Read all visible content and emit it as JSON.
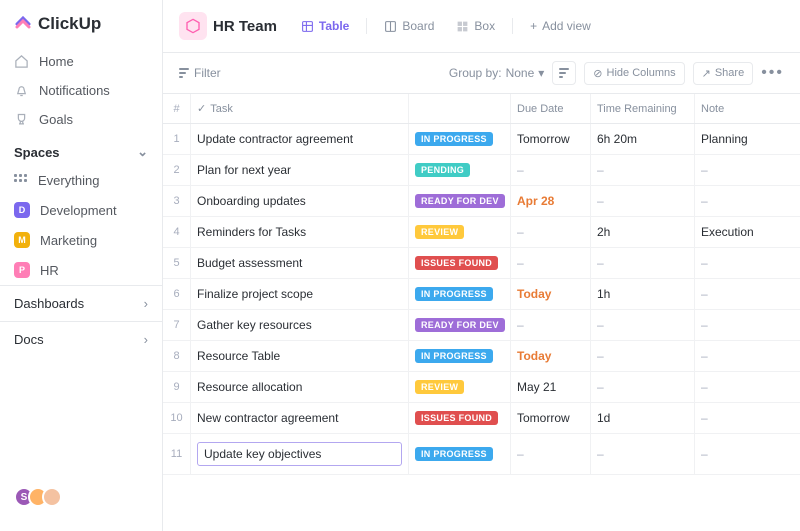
{
  "brand": "ClickUp",
  "nav": {
    "home": "Home",
    "notifications": "Notifications",
    "goals": "Goals"
  },
  "spaces_head": "Spaces",
  "everything": "Everything",
  "spaces": [
    {
      "letter": "D",
      "label": "Development",
      "color": "#7b68ee"
    },
    {
      "letter": "M",
      "label": "Marketing",
      "color": "#f2b10d"
    },
    {
      "letter": "P",
      "label": "HR",
      "color": "#ff7eb6"
    }
  ],
  "sections": {
    "dashboards": "Dashboards",
    "docs": "Docs"
  },
  "avatars": [
    "S",
    "",
    ""
  ],
  "header": {
    "title": "HR Team",
    "views": {
      "table": "Table",
      "board": "Board",
      "box": "Box",
      "add": "Add view"
    }
  },
  "toolbar": {
    "filter": "Filter",
    "group_by_label": "Group by:",
    "group_by_value": "None",
    "hide_cols": "Hide Columns",
    "share": "Share"
  },
  "columns": {
    "num": "#",
    "task": "Task",
    "status": "",
    "due": "Due Date",
    "time": "Time Remaining",
    "note": "Note"
  },
  "status_labels": {
    "inprogress": "IN PROGRESS",
    "pending": "PENDING",
    "readyfordev": "READY FOR DEV",
    "review": "REVIEW",
    "issuesfound": "ISSUES FOUND"
  },
  "rows": [
    {
      "n": "1",
      "task": "Update contractor agreement",
      "status": "inprogress",
      "due": "Tomorrow",
      "due_style": "",
      "time": "6h 20m",
      "note": "Planning"
    },
    {
      "n": "2",
      "task": "Plan for next year",
      "status": "pending",
      "due": "–",
      "due_style": "dash",
      "time": "–",
      "note": "–"
    },
    {
      "n": "3",
      "task": "Onboarding updates",
      "status": "readyfordev",
      "due": "Apr 28",
      "due_style": "orange",
      "time": "–",
      "note": "–"
    },
    {
      "n": "4",
      "task": "Reminders for Tasks",
      "status": "review",
      "due": "–",
      "due_style": "dash",
      "time": "2h",
      "note": "Execution"
    },
    {
      "n": "5",
      "task": "Budget assessment",
      "status": "issuesfound",
      "due": "–",
      "due_style": "dash",
      "time": "–",
      "note": "–"
    },
    {
      "n": "6",
      "task": "Finalize project scope",
      "status": "inprogress",
      "due": "Today",
      "due_style": "orange",
      "time": "1h",
      "note": "–"
    },
    {
      "n": "7",
      "task": "Gather key resources",
      "status": "readyfordev",
      "due": "–",
      "due_style": "dash",
      "time": "–",
      "note": "–"
    },
    {
      "n": "8",
      "task": "Resource Table",
      "status": "inprogress",
      "due": "Today",
      "due_style": "orange",
      "time": "–",
      "note": "–"
    },
    {
      "n": "9",
      "task": "Resource allocation",
      "status": "review",
      "due": "May 21",
      "due_style": "",
      "time": "–",
      "note": "–"
    },
    {
      "n": "10",
      "task": "New contractor agreement",
      "status": "issuesfound",
      "due": "Tomorrow",
      "due_style": "",
      "time": "1d",
      "note": "–"
    },
    {
      "n": "11",
      "task": "Update key objectives",
      "status": "inprogress",
      "due": "–",
      "due_style": "dash",
      "time": "–",
      "note": "–",
      "editing": true
    }
  ]
}
